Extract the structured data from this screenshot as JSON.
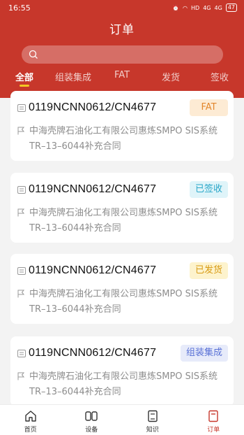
{
  "status_bar": {
    "time": "16:55",
    "network": "HD",
    "signal1": "4G",
    "signal2": "4G",
    "battery": "47"
  },
  "header": {
    "title": "订单"
  },
  "search": {
    "placeholder": ""
  },
  "tabs": [
    {
      "label": "全部",
      "active": true
    },
    {
      "label": "组装集成",
      "active": false
    },
    {
      "label": "FAT",
      "active": false
    },
    {
      "label": "发货",
      "active": false
    },
    {
      "label": "签收",
      "active": false
    }
  ],
  "orders": [
    {
      "number": "0119NCNN0612/CN4677",
      "desc": "中海壳牌石油化工有限公司惠炼SMPO SIS系统TR–13–6044补充合同",
      "status": "FAT",
      "status_type": "fat"
    },
    {
      "number": "0119NCNN0612/CN4677",
      "desc": "中海壳牌石油化工有限公司惠炼SMPO SIS系统TR–13–6044补充合同",
      "status": "已签收",
      "status_type": "signed"
    },
    {
      "number": "0119NCNN0612/CN4677",
      "desc": "中海壳牌石油化工有限公司惠炼SMPO SIS系统TR–13–6044补充合同",
      "status": "已发货",
      "status_type": "shipped"
    },
    {
      "number": "0119NCNN0612/CN4677",
      "desc": "中海壳牌石油化工有限公司惠炼SMPO SIS系统TR–13–6044补充合同",
      "status": "组装集成",
      "status_type": "assembly"
    }
  ],
  "bottom_nav": [
    {
      "label": "首页",
      "icon": "home-icon",
      "active": false
    },
    {
      "label": "设备",
      "icon": "device-icon",
      "active": false
    },
    {
      "label": "知识",
      "icon": "knowledge-icon",
      "active": false
    },
    {
      "label": "订单",
      "icon": "order-icon",
      "active": true
    }
  ],
  "colors": {
    "primary": "#c7372b",
    "tab_indicator": "#f3c623"
  }
}
